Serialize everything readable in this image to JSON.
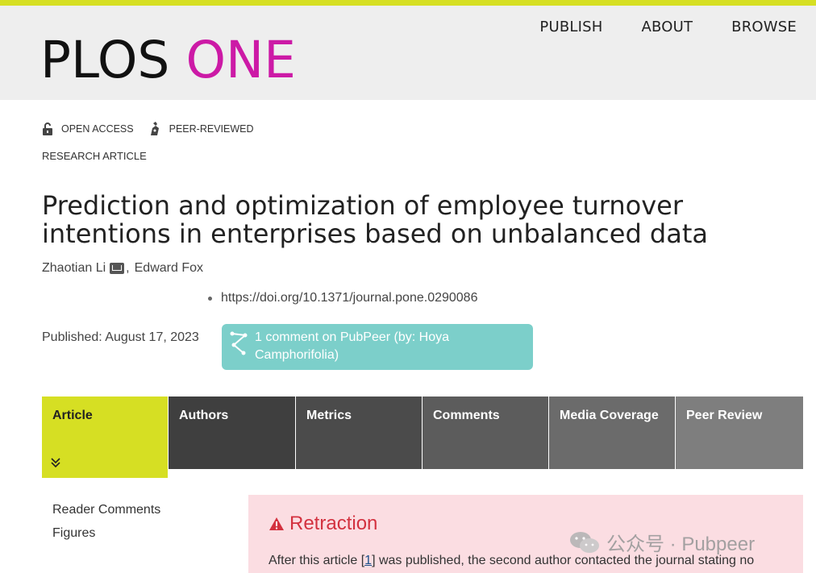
{
  "header": {
    "logo_plos": "PLOS",
    "logo_one": "ONE",
    "nav": [
      "PUBLISH",
      "ABOUT",
      "BROWSE"
    ],
    "accent_color": "#d6df23",
    "brand_color": "#cc1aa6"
  },
  "badges": {
    "open_access": "OPEN ACCESS",
    "peer_reviewed": "PEER-REVIEWED",
    "article_type": "RESEARCH ARTICLE"
  },
  "article": {
    "title": "Prediction and optimization of employee turnover intentions in enterprises based on unbalanced data",
    "author1": "Zhaotian Li",
    "separator": ",",
    "author2": "Edward Fox",
    "doi": "https://doi.org/10.1371/journal.pone.0290086",
    "published": "Published: August 17, 2023"
  },
  "pubpeer": {
    "text": "1 comment on PubPeer (by: Hoya Camphorifolia)",
    "color": "#7ccfca"
  },
  "tabs": [
    {
      "label": "Article",
      "color": "#d6df23"
    },
    {
      "label": "Authors",
      "color": "#3f3f3f"
    },
    {
      "label": "Metrics",
      "color": "#4b4b4b"
    },
    {
      "label": "Comments",
      "color": "#5c5c5c"
    },
    {
      "label": "Media Coverage",
      "color": "#6b6b6b"
    },
    {
      "label": "Peer Review",
      "color": "#7e7e7e"
    }
  ],
  "side_links": [
    "Reader Comments",
    "Figures"
  ],
  "retraction": {
    "heading": "Retraction",
    "text_before": "After this article [",
    "ref": "1",
    "text_after": "] was published, the second author contacted the journal stating no"
  },
  "watermark": {
    "text": "公众号 · Pubpeer"
  }
}
